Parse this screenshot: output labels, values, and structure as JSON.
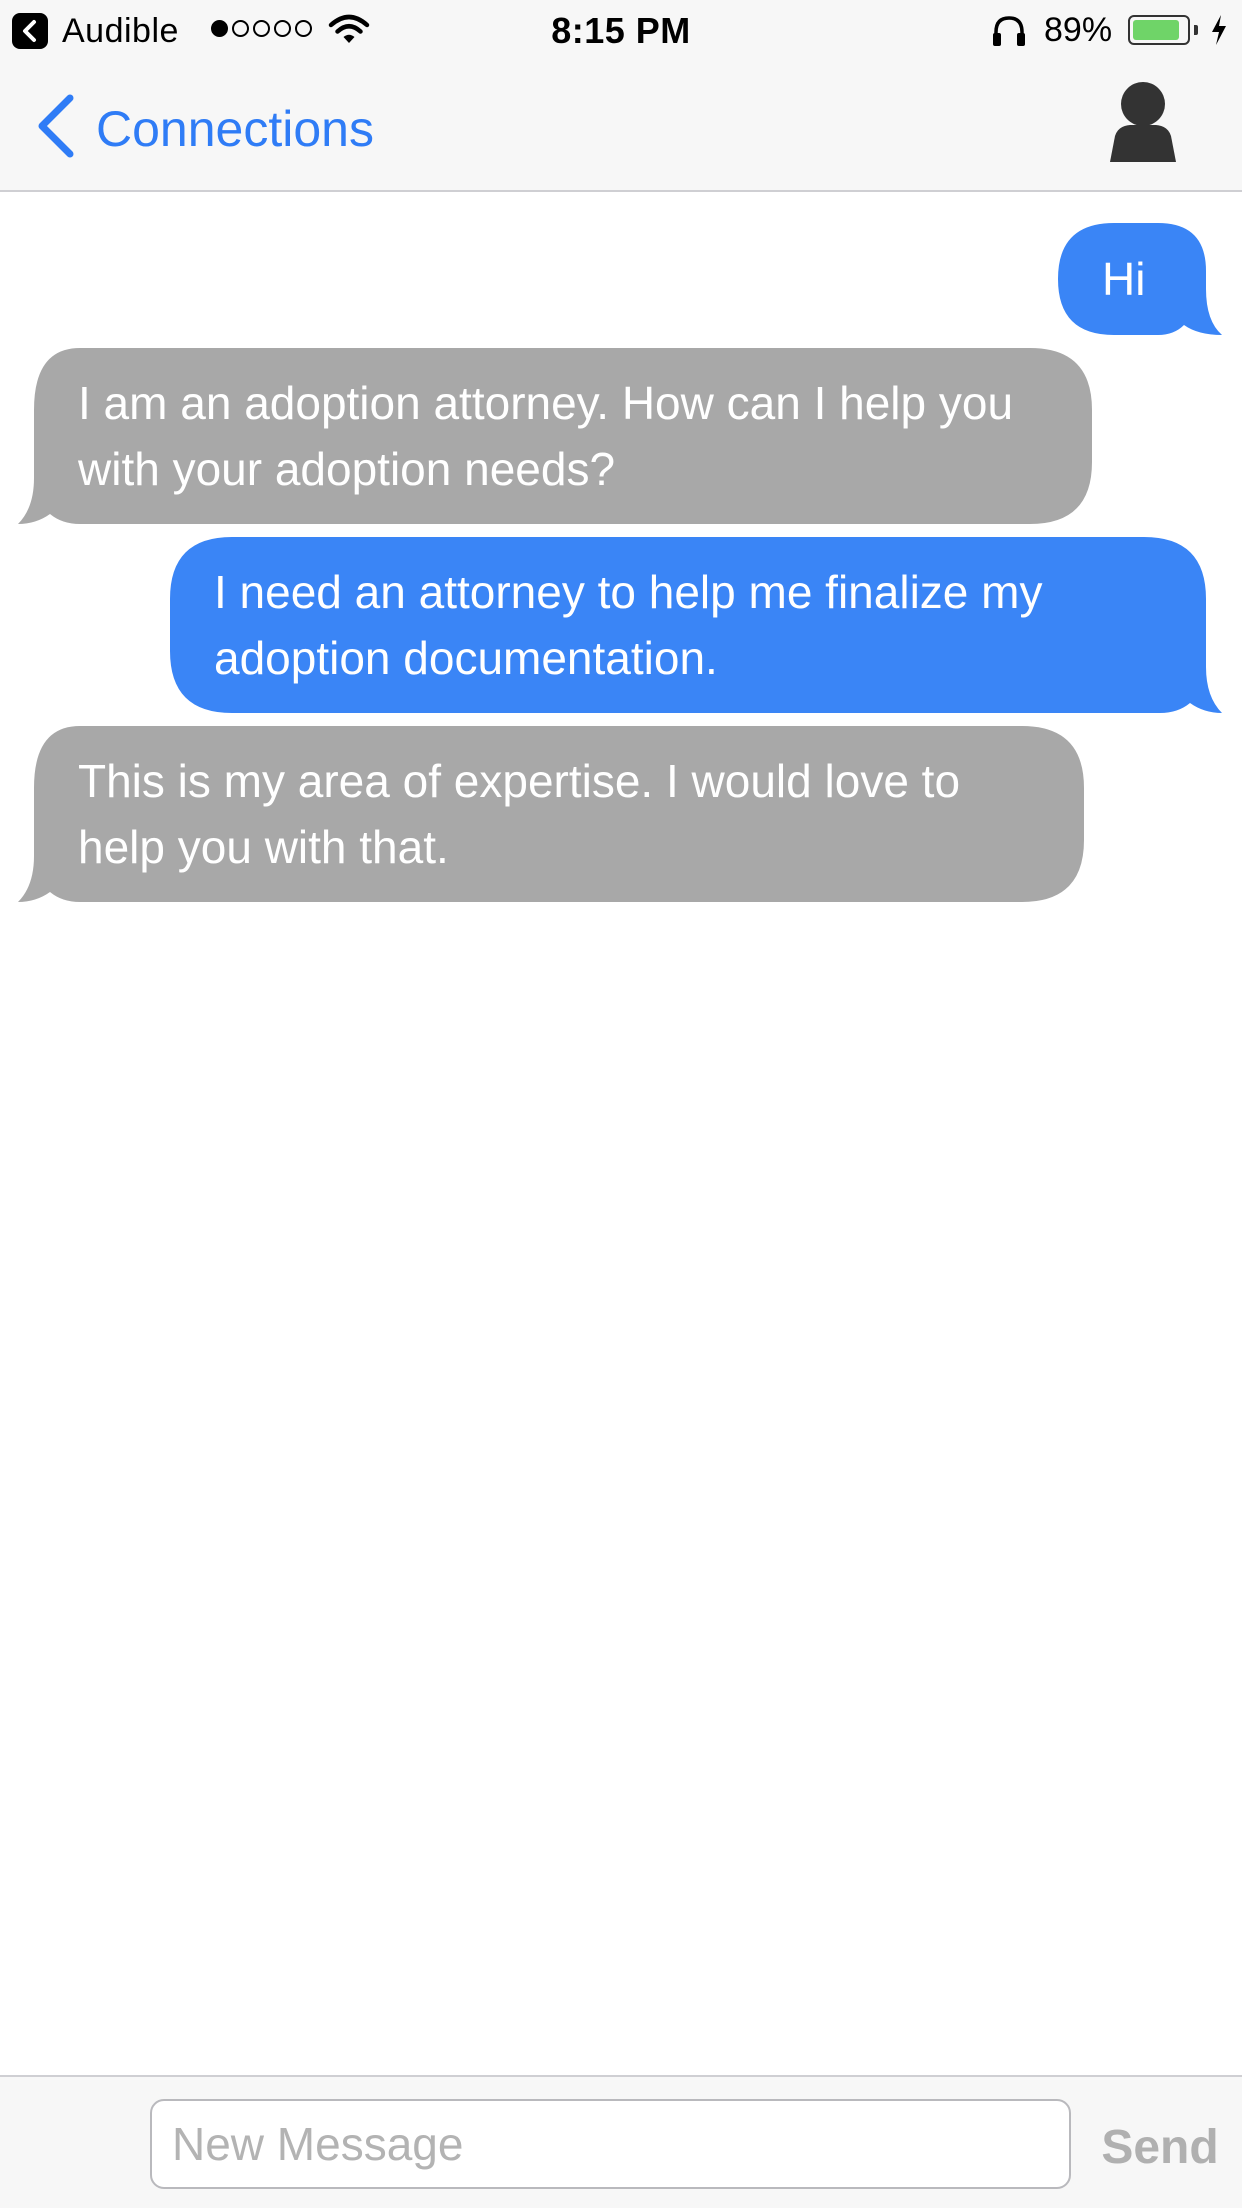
{
  "status_bar": {
    "back_app": "Audible",
    "signal_bars_filled": 1,
    "signal_bars_total": 5,
    "time": "8:15 PM",
    "battery_percent": "89%",
    "battery_level": 0.89,
    "battery_color": "#6fd468",
    "icons": [
      "back-app-icon",
      "wifi-icon",
      "headphones-icon",
      "battery-icon",
      "charging-bolt-icon"
    ]
  },
  "nav": {
    "back_label": "Connections",
    "back_icon": "chevron-left-icon",
    "avatar_icon": "person-avatar-icon",
    "accent_color": "#2f7cf6"
  },
  "messages": [
    {
      "direction": "outgoing",
      "text": "Hi"
    },
    {
      "direction": "incoming",
      "text": "I am an adoption attorney.  How can I help you with your adoption needs?"
    },
    {
      "direction": "outgoing",
      "text": "I need an attorney to help me finalize my adoption documentation."
    },
    {
      "direction": "incoming",
      "text": "This is my area of expertise.  I would love to help you with that."
    }
  ],
  "bubble_colors": {
    "outgoing": "#3a85f6",
    "incoming": "#a8a8a8"
  },
  "compose": {
    "placeholder": "New Message",
    "value": "",
    "send_label": "Send"
  }
}
